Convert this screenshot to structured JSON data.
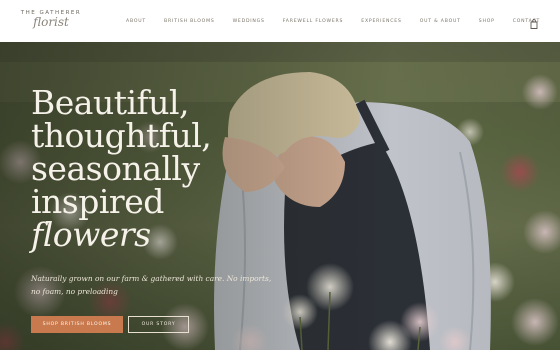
{
  "header": {
    "logo_top": "THE GATHERER",
    "logo_script": "florist",
    "nav": [
      {
        "label": "ABOUT"
      },
      {
        "label": "BRITISH BLOOMS"
      },
      {
        "label": "WEDDINGS"
      },
      {
        "label": "FAREWELL FLOWERS"
      },
      {
        "label": "EXPERIENCES"
      },
      {
        "label": "OUT & ABOUT"
      },
      {
        "label": "SHOP"
      },
      {
        "label": "CONTACT"
      }
    ],
    "cart_icon": "shopping-bag-icon"
  },
  "hero": {
    "headline_lines": [
      "Beautiful,",
      "thoughtful,",
      "seasonally",
      "inspired",
      "flowers"
    ],
    "subtext_lines": [
      "Naturally grown on our farm & gathered with care. No imports,",
      "no foam, no preloading"
    ],
    "primary_button": "SHOP BRITISH BLOOMS",
    "secondary_button": "OUR STORY"
  },
  "colors": {
    "accent_button": "#c87a4e",
    "header_bg": "#ffffff",
    "headline_text": "#f6f2ea"
  }
}
